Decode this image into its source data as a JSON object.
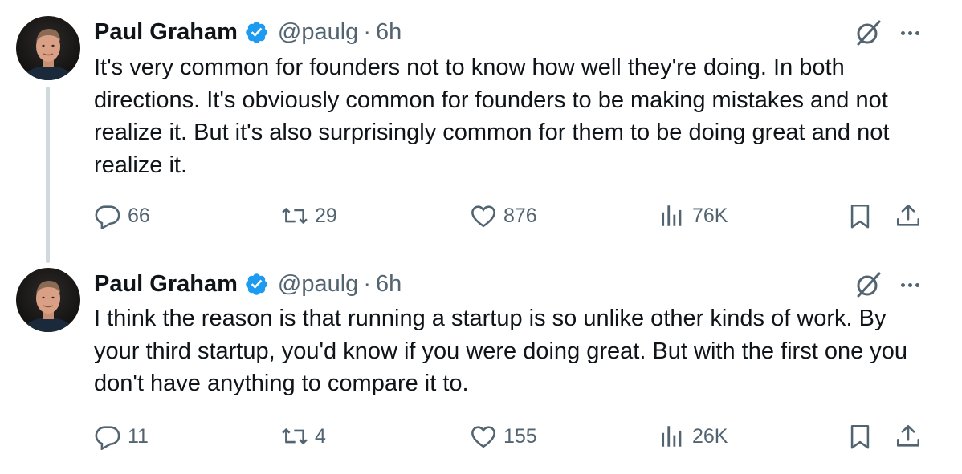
{
  "tweets": [
    {
      "author": "Paul Graham",
      "handle": "@paulg",
      "separator": "·",
      "time": "6h",
      "text": "It's very common for founders not to know how well they're doing. In both directions. It's obviously common for founders to be making mistakes and not realize it. But it's also surprisingly common for them to be doing great and not realize it.",
      "replies": "66",
      "reposts": "29",
      "likes": "876",
      "views": "76K"
    },
    {
      "author": "Paul Graham",
      "handle": "@paulg",
      "separator": "·",
      "time": "6h",
      "text": "I think the reason is that running a startup is so unlike other kinds of work. By your third startup, you'd know if you were doing great. But with the first one you don't have anything to compare it to.",
      "replies": "11",
      "reposts": "4",
      "likes": "155",
      "views": "26K"
    }
  ],
  "colors": {
    "text": "#0f1419",
    "secondary": "#536471",
    "verified": "#1d9bf0",
    "thread_line": "#cfd9de"
  },
  "icons": [
    "verified-badge-icon",
    "grok-icon",
    "more-icon",
    "reply-icon",
    "repost-icon",
    "like-icon",
    "views-icon",
    "bookmark-icon",
    "share-icon"
  ]
}
